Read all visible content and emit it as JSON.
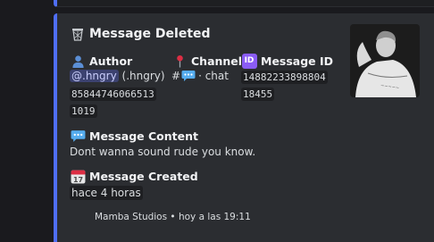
{
  "embed": {
    "accent": "#4f6ef7",
    "title": "Message Deleted",
    "title_icon": "wastebasket-icon",
    "author": {
      "label": "Author",
      "icon": "bust-icon",
      "mention": "@.hngry",
      "name_paren": "(.hngry)",
      "id_line1": "85844746066513",
      "id_line2": "1019"
    },
    "channel": {
      "label": "Channel",
      "icon": "pushpin-icon",
      "hash": "#",
      "channel_icon": "speech-bubble-icon",
      "name": "· chat"
    },
    "message_id": {
      "label": "Message ID",
      "icon": "id-badge-icon",
      "badge_text": "ID",
      "id_line1": "14882233898804",
      "id_line2": "18455"
    },
    "content": {
      "label": "Message Content",
      "icon": "speech-bubble-icon",
      "text": "Dont wanna sound rude you know."
    },
    "created": {
      "label": "Message Created",
      "icon": "calendar-icon",
      "calendar_day": "17",
      "time": "hace 4 horas"
    },
    "footer": {
      "text": "Mamba Studios • hoy a las 19:11"
    },
    "thumbnail": "author-photo"
  }
}
